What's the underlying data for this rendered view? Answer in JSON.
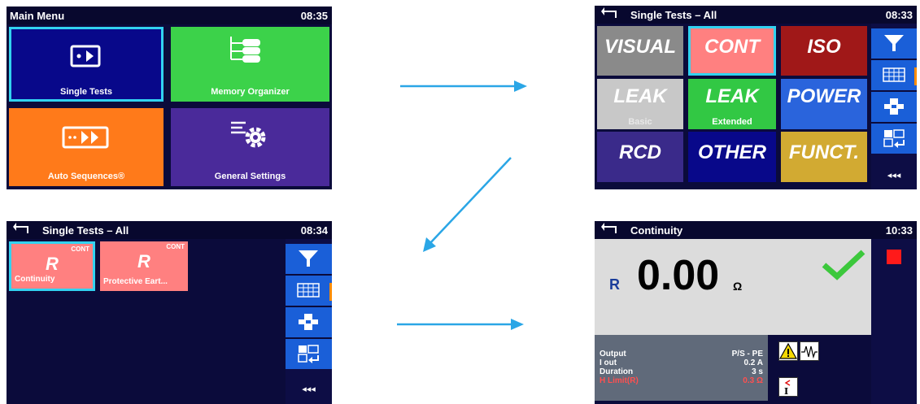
{
  "main_menu": {
    "title": "Main Menu",
    "clock": "08:35",
    "tiles": {
      "single_tests": "Single Tests",
      "memory_organizer": "Memory Organizer",
      "auto_sequences": "Auto Sequences®",
      "general_settings": "General Settings"
    },
    "colors": {
      "single_tests": "#08088a",
      "memory_organizer": "#3cd24a",
      "auto_sequences": "#ff7a1a",
      "general_settings": "#4a2a9a",
      "selection": "#32d2f0"
    }
  },
  "single_tests_grid": {
    "title": "Single Tests – All",
    "clock": "08:33",
    "tests": [
      {
        "label": "VISUAL",
        "sub": "",
        "color": "#8a8a8a"
      },
      {
        "label": "CONT",
        "sub": "",
        "color": "#ff8080"
      },
      {
        "label": "ISO",
        "sub": "",
        "color": "#a01818"
      },
      {
        "label": "LEAK",
        "sub": "Basic",
        "color": "#c8c8c8"
      },
      {
        "label": "LEAK",
        "sub": "Extended",
        "color": "#32c844"
      },
      {
        "label": "POWER",
        "sub": "",
        "color": "#2a64dc"
      },
      {
        "label": "RCD",
        "sub": "",
        "color": "#3a2a8a"
      },
      {
        "label": "OTHER",
        "sub": "",
        "color": "#08088a"
      },
      {
        "label": "FUNCT.",
        "sub": "",
        "color": "#d2aa32"
      }
    ],
    "more": "◂◂◂"
  },
  "single_tests_list": {
    "title": "Single Tests – All",
    "clock": "08:34",
    "tests": [
      {
        "tag": "CONT",
        "symbol": "R",
        "name": "Continuity"
      },
      {
        "tag": "CONT",
        "symbol": "R",
        "name": "Protective Eart..."
      }
    ],
    "more": "◂◂◂"
  },
  "continuity": {
    "title": "Continuity",
    "clock": "10:33",
    "result_symbol": "R",
    "result_value": "0.00",
    "result_unit": "Ω",
    "params": [
      {
        "name": "Output",
        "value": "P/S - PE",
        "highlight": false
      },
      {
        "name": "I out",
        "value": "0.2 A",
        "highlight": false
      },
      {
        "name": "Duration",
        "value": "3 s",
        "highlight": false
      },
      {
        "name": "H Limit(R)",
        "value": "0.3 Ω",
        "highlight": true
      }
    ]
  },
  "icons": [
    "back-arrow-icon",
    "filter-icon",
    "grid-view-icon",
    "list-view-icon",
    "swap-icon",
    "check-icon",
    "stop-icon",
    "warning-icon",
    "waveform-icon",
    "limit-icon"
  ]
}
